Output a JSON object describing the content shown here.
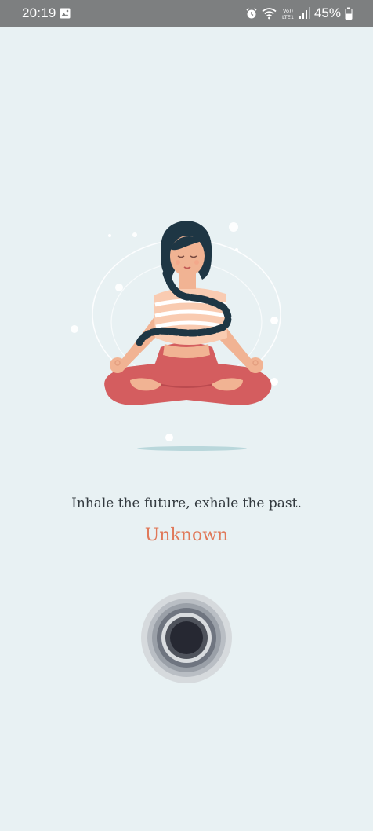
{
  "status_bar": {
    "time": "20:19",
    "battery_percent": "45%",
    "icons": [
      "gallery-icon",
      "alarm-icon",
      "wifi-icon",
      "volte-icon",
      "signal-icon",
      "battery-icon"
    ]
  },
  "meditation": {
    "illustration": "meditating-woman-illustration",
    "quote": "Inhale the future, exhale the past.",
    "author": "Unknown",
    "breath_button_icon": "breath-circle-icon"
  },
  "colors": {
    "background": "#e8f1f3",
    "status_bar": "#7d7f80",
    "author_accent": "#e0795a",
    "button_core": "#262832"
  }
}
